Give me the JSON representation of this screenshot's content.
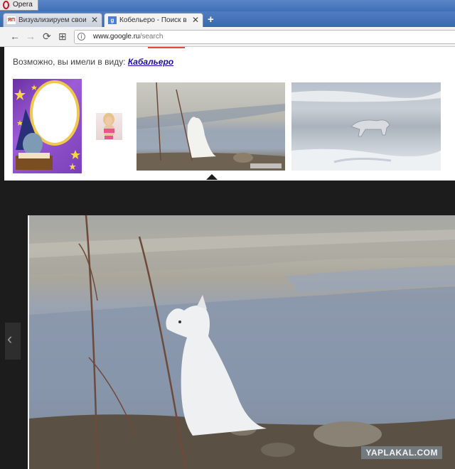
{
  "window": {
    "app_label": "Opera"
  },
  "tabs": [
    {
      "favicon": "ЯП",
      "title": "Визуализируем свои ни...",
      "close": "✕"
    },
    {
      "favicon": "g",
      "title": "Кобельеро - Поиск в Goo",
      "close": "✕"
    }
  ],
  "new_tab": "+",
  "nav": {
    "back": "←",
    "forward": "→",
    "reload": "⟳",
    "speed_dial": "⊞",
    "address_domain": "www.google.ru",
    "address_path": "/search"
  },
  "search": {
    "did_you_mean_prefix": "Возможно, вы имели в виду:",
    "suggestion": "Кабальеро"
  },
  "viewer": {
    "prev_glyph": "‹",
    "watermark": "YAPLAKAL.COM"
  },
  "icons": {
    "back": "arrow-left-icon",
    "forward": "arrow-right-icon",
    "reload": "reload-icon",
    "speed_dial": "grid-icon",
    "address": "info-icon",
    "prev": "chevron-left-icon"
  }
}
